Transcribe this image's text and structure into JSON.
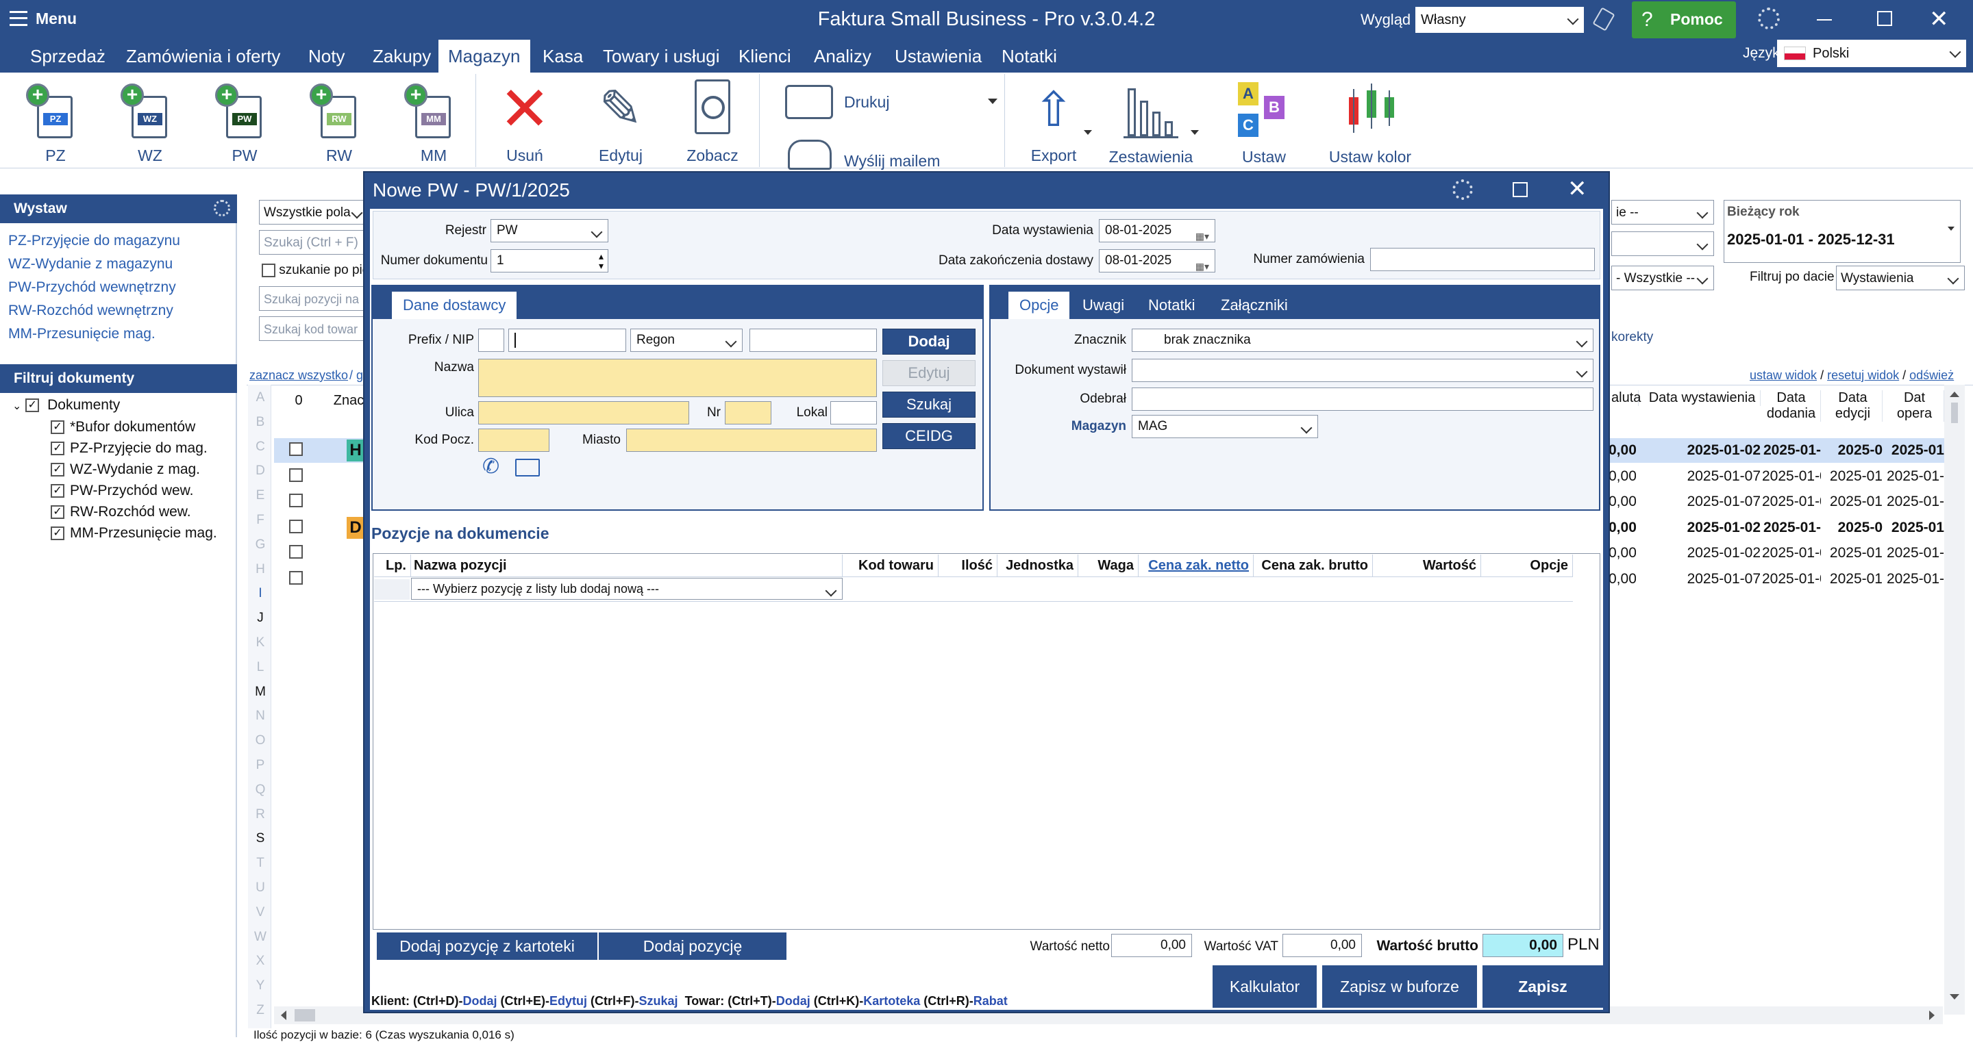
{
  "app": {
    "menu_label": "Menu",
    "title": "Faktura Small Business - Pro v.3.0.4.2",
    "appearance_label": "Wygląd",
    "appearance_value": "Własny",
    "help_label": "Pomoc",
    "language_label": "Język",
    "language_value": "Polski"
  },
  "menubar": {
    "items": [
      "Sprzedaż",
      "Zamówienia i oferty",
      "Noty",
      "Zakupy",
      "Magazyn",
      "Kasa",
      "Towary i usługi",
      "Klienci",
      "Analizy",
      "Ustawienia",
      "Notatki"
    ],
    "active_index": 4
  },
  "ribbon": {
    "doc_buttons": [
      {
        "label": "PZ",
        "tag": "PZ",
        "color": "#2b6fd6"
      },
      {
        "label": "WZ",
        "tag": "WZ",
        "color": "#2b4f8a"
      },
      {
        "label": "PW",
        "tag": "PW",
        "color": "#1c4a1f"
      },
      {
        "label": "RW",
        "tag": "RW",
        "color": "#8cc06a"
      },
      {
        "label": "MM",
        "tag": "MM",
        "color": "#8a7aa0"
      }
    ],
    "delete": "Usuń",
    "edit": "Edytuj",
    "view": "Zobacz",
    "print": "Drukuj",
    "email": "Wyślij mailem",
    "export": "Export",
    "reports": "Zestawienia",
    "set": "Ustaw",
    "set_color": "Ustaw kolor"
  },
  "left_panel": {
    "issue_title": "Wystaw",
    "issue_links": [
      "PZ-Przyjęcie do magazynu",
      "WZ-Wydanie z magazynu",
      "PW-Przychód wewnętrzny",
      "RW-Rozchód wewnętrzny",
      "MM-Przesunięcie mag."
    ],
    "filter_title": "Filtruj dokumenty",
    "tree_root": "Dokumenty",
    "tree_items": [
      "*Bufor dokumentów",
      "PZ-Przyjęcie do mag.",
      "WZ-Wydanie z mag.",
      "PW-Przychód wew.",
      "RW-Rozchód wew.",
      "MM-Przesunięcie mag."
    ]
  },
  "search": {
    "field_select": "Wszystkie pola",
    "search_placeholder": "Szukaj (Ctrl + F)",
    "search_in_label": "szukanie po pie",
    "search_positions": "Szukaj pozycji na",
    "search_code": "Szukaj kod towar",
    "select_all": "zaznacz wszystko",
    "select_all_sep": "/ g"
  },
  "right_filters": {
    "all_1": "ie --",
    "all_2": "- Wszystkie --",
    "current_year_label": "Bieżący rok",
    "current_year_range": "2025-01-01 - 2025-12-31",
    "filter_by_date_label": "Filtruj po dacie",
    "filter_by_date_value": "Wystawienia",
    "corrections": "korekty",
    "view_links": [
      "ustaw widok",
      "resetuj widok",
      "odśwież"
    ]
  },
  "grid": {
    "alpha": [
      "A",
      "B",
      "C",
      "D",
      "E",
      "F",
      "G",
      "H",
      "I",
      "J",
      "K",
      "L",
      "M",
      "N",
      "O",
      "P",
      "Q",
      "R",
      "S",
      "T",
      "U",
      "V",
      "W",
      "X",
      "Y",
      "Z"
    ],
    "col_zero": "0",
    "col_mark": "Znacz",
    "headers_right": [
      "aluta",
      "Data wystawienia",
      "Data dodania",
      "Data edycji",
      "Dat opera"
    ],
    "rows": [
      {
        "val": "0,00",
        "issued": "2025-01-02",
        "added": "2025-01-",
        "edited": "2025-0",
        "op": "2025-01",
        "bold": true,
        "selected": true,
        "badge": "H"
      },
      {
        "val": "0,00",
        "issued": "2025-01-07",
        "added": "2025-01-0",
        "edited": "2025-01",
        "op": "2025-01-",
        "bold": false,
        "selected": false,
        "badge": ""
      },
      {
        "val": "0,00",
        "issued": "2025-01-07",
        "added": "2025-01-0",
        "edited": "2025-01",
        "op": "2025-01-",
        "bold": false,
        "selected": false,
        "badge": ""
      },
      {
        "val": "0,00",
        "issued": "2025-01-02",
        "added": "2025-01-",
        "edited": "2025-0",
        "op": "2025-01",
        "bold": true,
        "selected": false,
        "badge": "D"
      },
      {
        "val": "0,00",
        "issued": "2025-01-02",
        "added": "2025-01-0",
        "edited": "2025-01",
        "op": "2025-01-",
        "bold": false,
        "selected": false,
        "badge": ""
      },
      {
        "val": "0,00",
        "issued": "2025-01-07",
        "added": "2025-01-0",
        "edited": "2025-01",
        "op": "2025-01-",
        "bold": false,
        "selected": false,
        "badge": ""
      }
    ],
    "status_text": "Ilość pozycji w bazie: 6   (Czas wyszukania 0,016 s)"
  },
  "dialog": {
    "title": "Nowe PW - PW/1/2025",
    "registry_label": "Rejestr",
    "registry_value": "PW",
    "docnum_label": "Numer dokumentu",
    "docnum_value": "1",
    "issue_date_label": "Data wystawienia",
    "issue_date_value": "08-01-2025",
    "delivery_date_label": "Data zakończenia dostawy",
    "delivery_date_value": "08-01-2025",
    "order_num_label": "Numer zamówienia",
    "order_num_value": "",
    "supplier_tab": "Dane dostawcy",
    "prefix_label": "Prefix / NIP",
    "regon_value": "Regon",
    "name_label": "Nazwa",
    "street_label": "Ulica",
    "nr_label": "Nr",
    "local_label": "Lokal",
    "postcode_label": "Kod Pocz.",
    "city_label": "Miasto",
    "btn_add": "Dodaj",
    "btn_edit": "Edytuj",
    "btn_search": "Szukaj",
    "btn_ceidg": "CEIDG",
    "right_tabs": [
      "Opcje",
      "Uwagi",
      "Notatki",
      "Załączniki"
    ],
    "tag_label": "Znacznik",
    "tag_value": "brak znacznika",
    "issued_by_label": "Dokument wystawił",
    "issued_by_value": "",
    "received_label": "Odebrał",
    "received_value": "",
    "warehouse_label": "Magazyn",
    "warehouse_value": "MAG",
    "positions_title": "Pozycje na dokumencie",
    "col_lp": "Lp.",
    "col_name": "Nazwa pozycji",
    "col_code": "Kod towaru",
    "col_qty": "Ilość",
    "col_unit": "Jednostka",
    "col_weight": "Waga",
    "col_net_price": "Cena zak. netto",
    "col_gross_price": "Cena zak. brutto",
    "col_value": "Wartość",
    "col_options": "Opcje",
    "select_position": "--- Wybierz pozycję z listy lub dodaj nową ---",
    "btn_add_from_catalog": "Dodaj pozycję z kartoteki",
    "btn_add_position": "Dodaj pozycję",
    "net_label": "Wartość netto",
    "net_value": "0,00",
    "vat_label": "Wartość VAT",
    "vat_value": "0,00",
    "gross_label": "Wartość brutto",
    "gross_value": "0,00",
    "currency": "PLN",
    "btn_calculator": "Kalkulator",
    "btn_save_buffer": "Zapisz w buforze",
    "btn_save": "Zapisz",
    "shortcuts": [
      {
        "t": "Klient: (Ctrl+D)-",
        "c": "#111"
      },
      {
        "t": "Dodaj",
        "c": "#2b4fb0"
      },
      {
        "t": " (Ctrl+E)-",
        "c": "#111"
      },
      {
        "t": "Edytuj",
        "c": "#2b4fb0"
      },
      {
        "t": " (Ctrl+F)-",
        "c": "#111"
      },
      {
        "t": "Szukaj",
        "c": "#2b4fb0"
      },
      {
        "t": "  Towar: (Ctrl+T)-",
        "c": "#111"
      },
      {
        "t": "Dodaj",
        "c": "#2b4fb0"
      },
      {
        "t": " (Ctrl+K)-",
        "c": "#111"
      },
      {
        "t": "Kartoteka",
        "c": "#2b4fb0"
      },
      {
        "t": " (Ctrl+R)-",
        "c": "#111"
      },
      {
        "t": "Rabat",
        "c": "#2b4fb0"
      }
    ]
  }
}
